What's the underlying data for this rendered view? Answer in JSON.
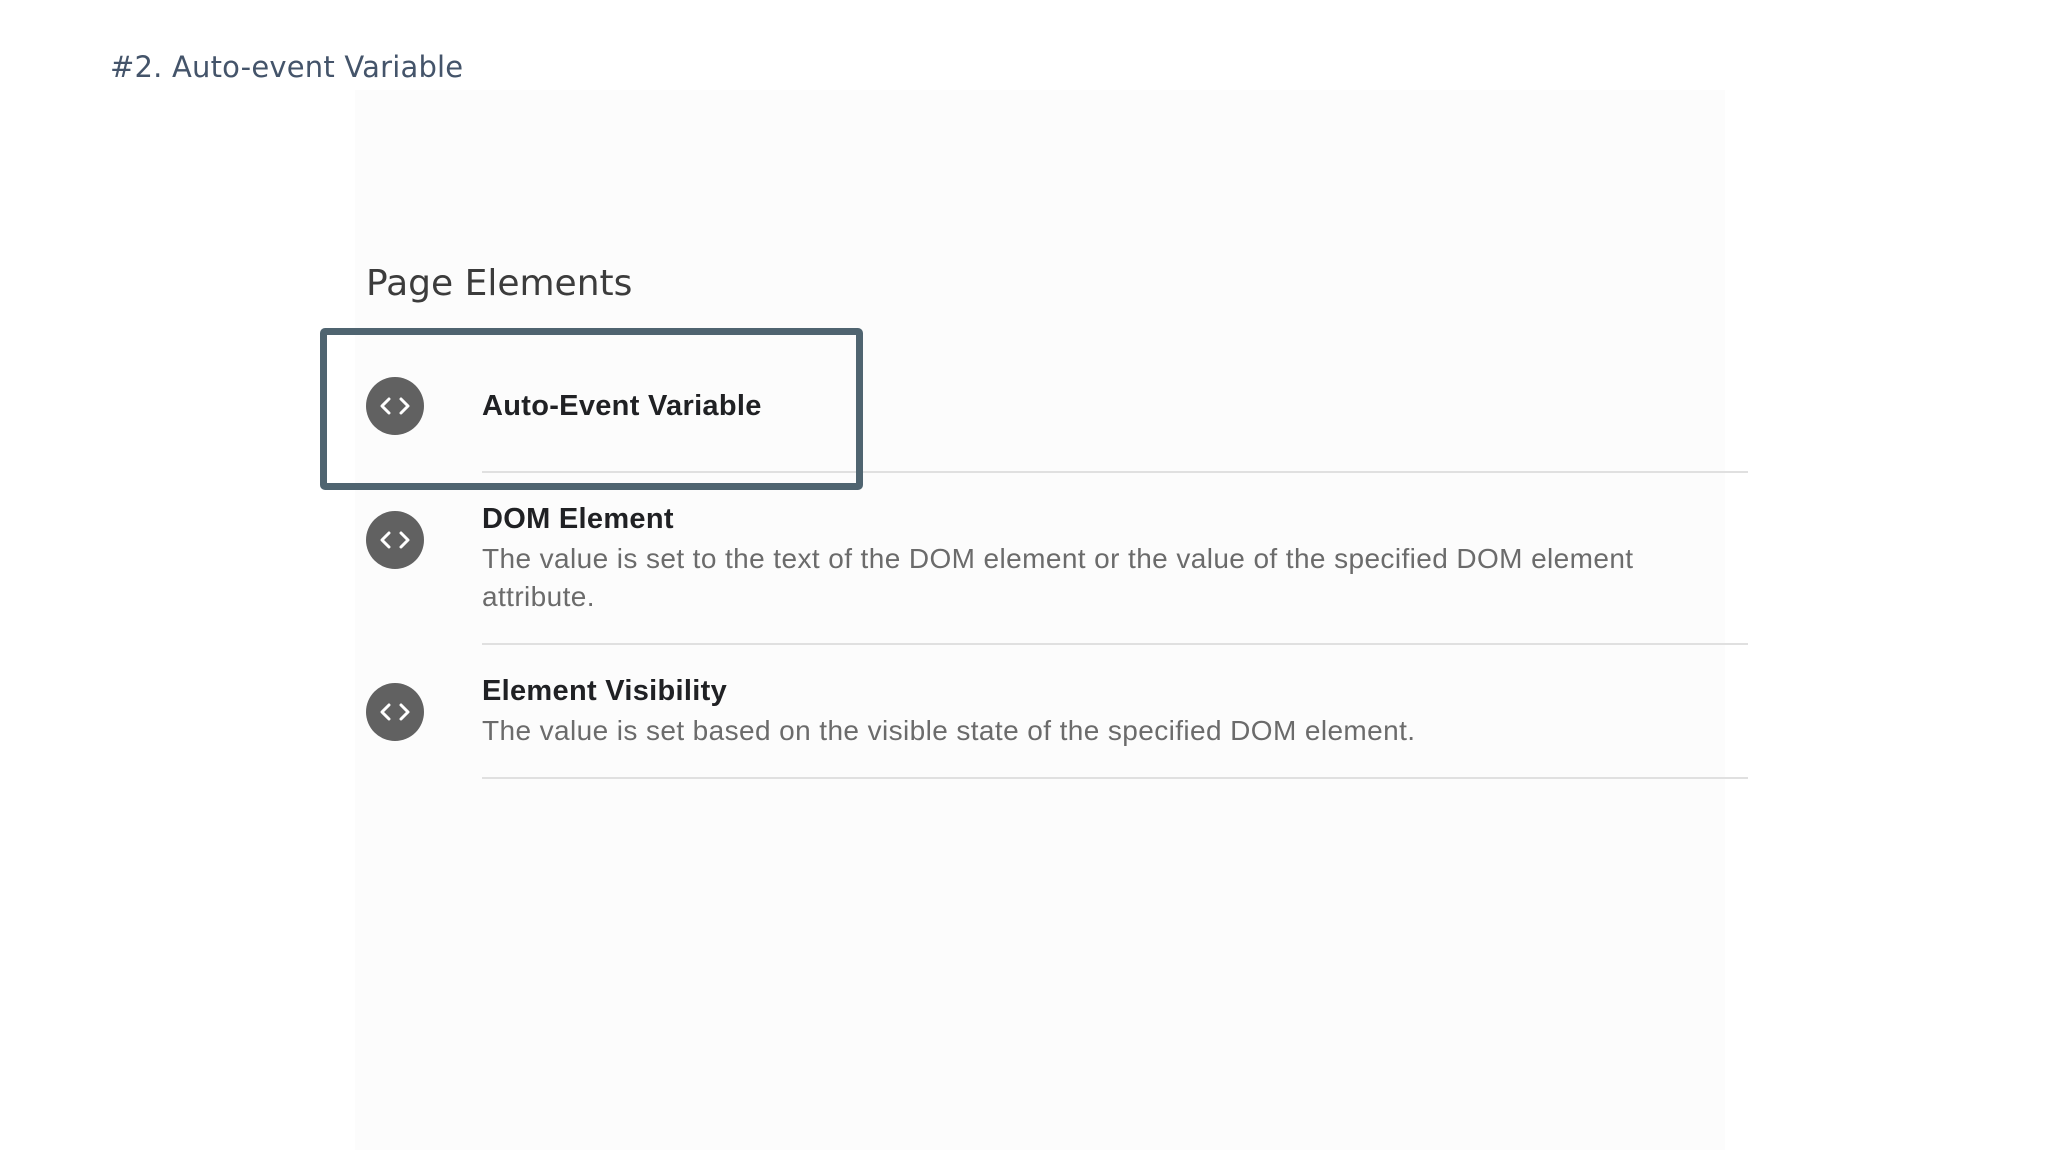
{
  "slide": {
    "title": "#2. Auto-event Variable"
  },
  "panel": {
    "heading": "Page Elements",
    "items": [
      {
        "name": "Auto-Event Variable",
        "description": "",
        "icon": "code-icon",
        "highlighted": true
      },
      {
        "name": "DOM Element",
        "description": "The value is set to the text of the DOM element or the value of the specified DOM element attribute.",
        "icon": "code-icon",
        "highlighted": false
      },
      {
        "name": "Element Visibility",
        "description": "The value is set based on the visible state of the specified DOM element.",
        "icon": "code-icon",
        "highlighted": false
      }
    ]
  },
  "colors": {
    "title": "#44546a",
    "highlight_border": "#4f6470",
    "icon_background": "#616161",
    "divider": "#e0e0e0"
  }
}
